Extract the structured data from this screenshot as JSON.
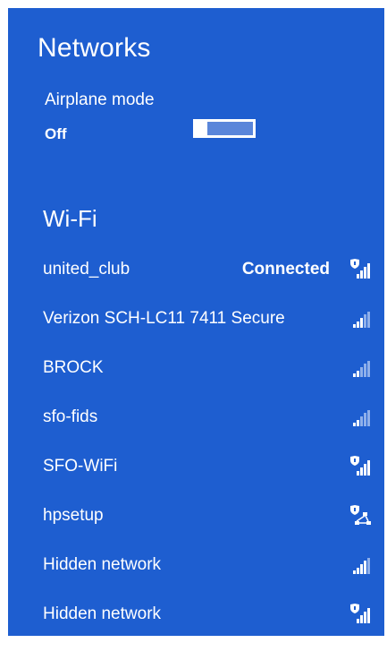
{
  "panel": {
    "title": "Networks"
  },
  "airplane": {
    "label": "Airplane mode",
    "state": "Off",
    "enabled": false
  },
  "wifi": {
    "heading": "Wi-Fi",
    "networks": [
      {
        "name": "united_club",
        "status": "Connected",
        "icon": "wifi-signal-secured-icon"
      },
      {
        "name": "Verizon SCH-LC11 7411 Secure",
        "status": "",
        "icon": "wifi-signal-icon"
      },
      {
        "name": "BROCK",
        "status": "",
        "icon": "wifi-signal-icon"
      },
      {
        "name": "sfo-fids",
        "status": "",
        "icon": "wifi-signal-icon"
      },
      {
        "name": "SFO-WiFi",
        "status": "",
        "icon": "wifi-signal-secured-icon"
      },
      {
        "name": "hpsetup",
        "status": "",
        "icon": "adhoc-network-secured-icon"
      },
      {
        "name": "Hidden network",
        "status": "",
        "icon": "wifi-signal-icon"
      },
      {
        "name": "Hidden network",
        "status": "",
        "icon": "wifi-signal-secured-icon"
      }
    ]
  },
  "colors": {
    "panel": "#1e5ed0",
    "text": "#ffffff",
    "toggle_track": "#5a86da"
  }
}
